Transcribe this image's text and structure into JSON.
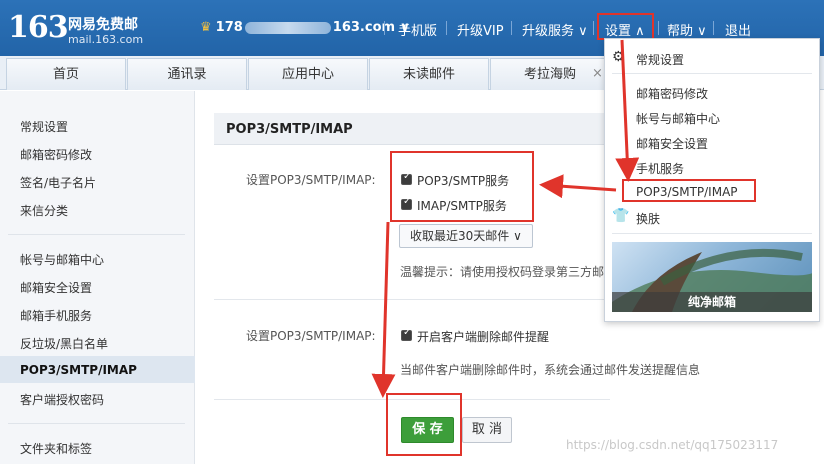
{
  "header": {
    "logo_number": "163",
    "logo_name": "网易免费邮",
    "logo_domain": "mail.163.com",
    "user_prefix": "178",
    "user_suffix": "163.com ∨",
    "nav": [
      "手机版",
      "升级VIP",
      "升级服务 ∨",
      "设置 ∧",
      "帮助 ∨",
      "退出"
    ]
  },
  "tabs": [
    "首页",
    "通讯录",
    "应用中心",
    "未读邮件",
    "考拉海购"
  ],
  "tab_close": "×",
  "sidebar": {
    "items": [
      "常规设置",
      "邮箱密码修改",
      "签名/电子名片",
      "来信分类",
      "帐号与邮箱中心",
      "邮箱安全设置",
      "邮箱手机服务",
      "反垃圾/黑白名单",
      "POP3/SMTP/IMAP",
      "客户端授权密码",
      "文件夹和标签"
    ]
  },
  "content": {
    "title": "POP3/SMTP/IMAP",
    "label1": "设置POP3/SMTP/IMAP:",
    "opt_pop3": "POP3/SMTP服务",
    "opt_imap": "IMAP/SMTP服务",
    "dropdown": "收取最近30天邮件 ∨",
    "hint": "温馨提示：请使用授权码登录第三方邮",
    "label2": "设置POP3/SMTP/IMAP:",
    "opt_delete": "开启客户端删除邮件提醒",
    "delete_hint": "当邮件客户端删除邮件时，系统会通过邮件发送提醒信息",
    "save": "保 存",
    "cancel": "取 消"
  },
  "menu": {
    "general": "常规设置",
    "items": [
      "邮箱密码修改",
      "帐号与邮箱中心",
      "邮箱安全设置",
      "手机服务",
      "POP3/SMTP/IMAP"
    ],
    "skin": "换肤",
    "skin_caption": "纯净邮箱"
  },
  "watermark": "https://blog.csdn.net/qq175023117",
  "colors": {
    "header": "#2a6db3",
    "highlight": "#e0342b",
    "save": "#3d9e3a"
  }
}
